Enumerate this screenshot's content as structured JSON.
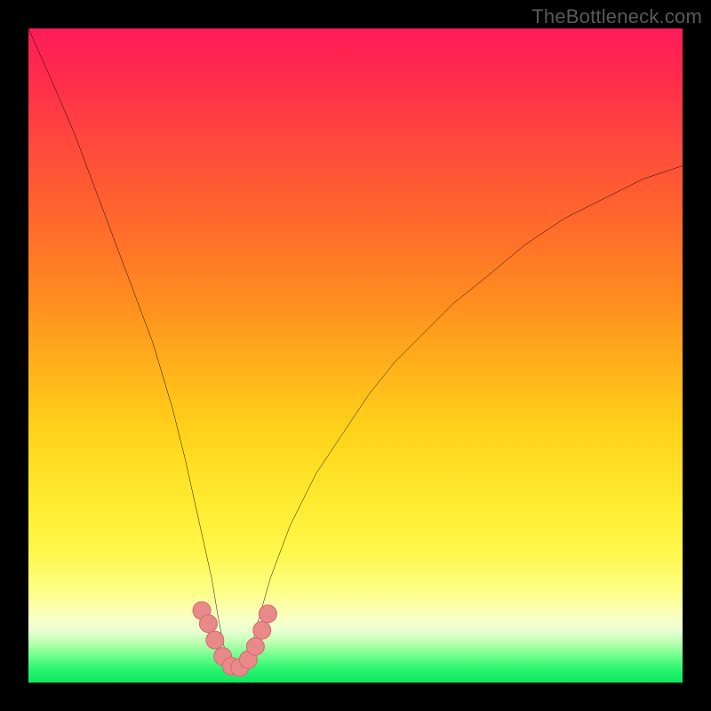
{
  "watermark": {
    "text": "TheBottleneck.com"
  },
  "colors": {
    "frame": "#000000",
    "curve_stroke": "#000000",
    "marker_fill": "#e98a8a",
    "marker_stroke": "#d46c6c",
    "watermark": "#595959"
  },
  "chart_data": {
    "type": "line",
    "title": "",
    "xlabel": "",
    "ylabel": "",
    "xlim": [
      0,
      100
    ],
    "ylim": [
      0,
      100
    ],
    "grid": false,
    "legend": false,
    "notes": "Axes are unlabeled in the original image; values are normalized 0–100 estimated from pixel position. Curve is a V-shaped bottleneck profile with minimum near x≈32.",
    "series": [
      {
        "name": "bottleneck-curve",
        "x": [
          0,
          4,
          7,
          10,
          13,
          16,
          19,
          22,
          24,
          26,
          28,
          29,
          30,
          31,
          32,
          33,
          34,
          35,
          37,
          40,
          44,
          48,
          52,
          56,
          60,
          65,
          70,
          76,
          82,
          88,
          94,
          100
        ],
        "values": [
          100,
          91,
          84,
          76,
          68,
          60,
          52,
          42,
          34,
          25,
          16,
          10,
          5,
          2,
          1,
          2,
          5,
          9,
          16,
          24,
          32,
          38,
          44,
          49,
          53,
          58,
          62,
          67,
          71,
          74,
          77,
          79
        ]
      }
    ],
    "markers": {
      "name": "threshold-dots",
      "x": [
        26.5,
        27.5,
        28.5,
        29.7,
        31.0,
        32.3,
        33.6,
        34.7,
        35.7,
        36.6
      ],
      "values": [
        11.0,
        9.0,
        6.5,
        4.0,
        2.5,
        2.3,
        3.5,
        5.5,
        8.0,
        10.5
      ]
    }
  }
}
